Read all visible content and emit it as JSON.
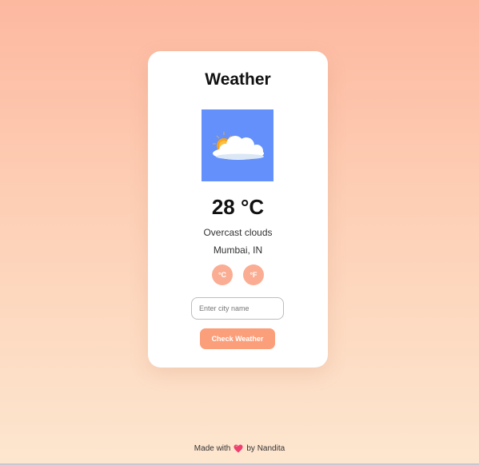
{
  "app": {
    "title": "Weather"
  },
  "weather": {
    "icon": "partly-cloudy-icon",
    "temperature": "28 °C",
    "description": "Overcast clouds",
    "location": "Mumbai, IN"
  },
  "units": {
    "celsius_label": "°C",
    "fahrenheit_label": "°F"
  },
  "search": {
    "placeholder": "Enter city name",
    "value": "",
    "button_label": "Check Weather"
  },
  "footer": {
    "prefix": "Made with",
    "icon": "heart-icon",
    "suffix": "by Nandita"
  },
  "colors": {
    "accent": "#fb9f7b",
    "unit_button": "#fbad93",
    "icon_background": "#6490fb"
  }
}
